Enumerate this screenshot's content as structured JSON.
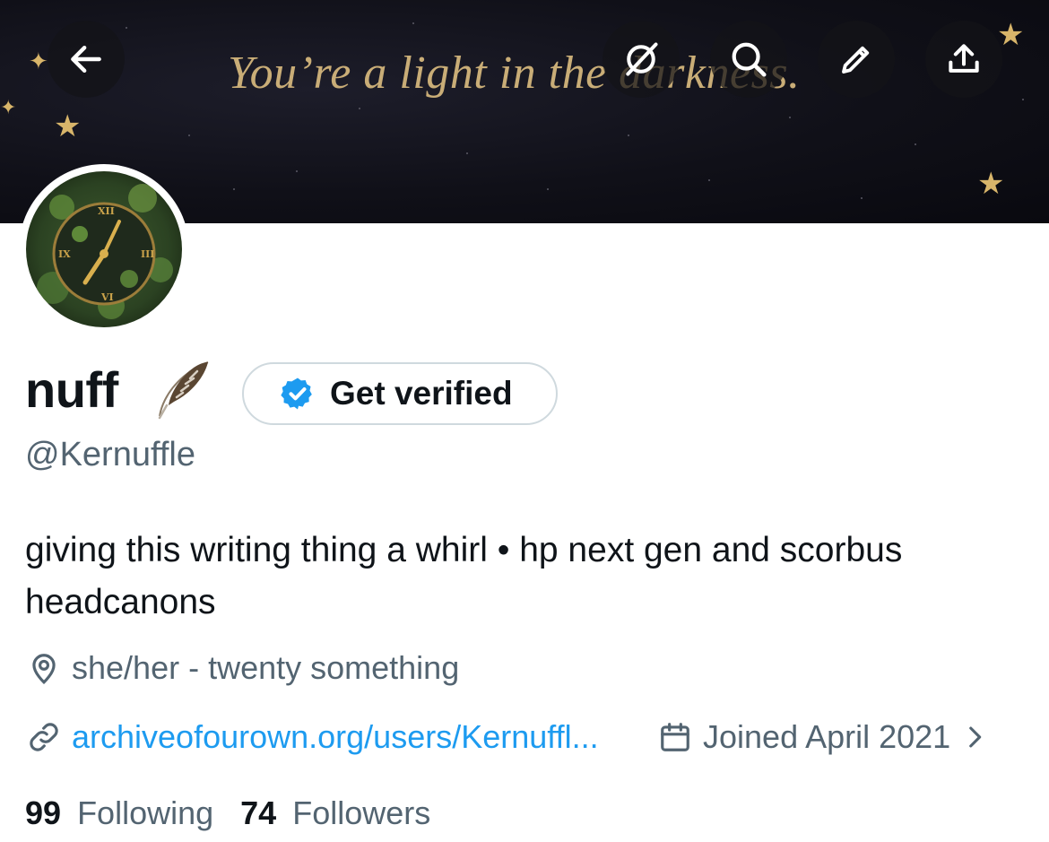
{
  "header": {
    "banner_quote": "You’re a light in the darkness.",
    "buttons": [
      "back-arrow-icon",
      "grok-icon",
      "search-icon",
      "edit-pencil-icon",
      "share-upload-icon"
    ]
  },
  "profile": {
    "display_name": "nuff",
    "name_emoji": "feather",
    "get_verified_label": "Get verified",
    "handle": "@Kernuffle",
    "bio": "giving this writing thing a whirl • hp next gen and scorbus headcanons",
    "location": "she/her - twenty something",
    "website": "archiveofourown.org/users/Kernuffl...",
    "joined": "Joined April 2021",
    "following_count": "99",
    "following_label": "Following",
    "followers_count": "74",
    "followers_label": "Followers"
  },
  "colors": {
    "link": "#1d9bf0",
    "secondary_text": "#536471",
    "verified_badge": "#1d9bf0",
    "banner_text": "#c9ad77"
  }
}
